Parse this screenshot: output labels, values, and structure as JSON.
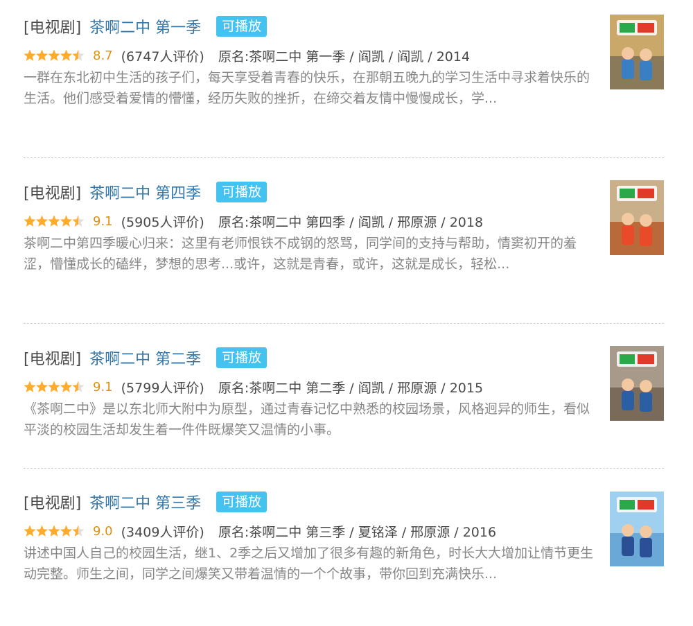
{
  "items": [
    {
      "category": "[电视剧]",
      "title": "茶啊二中 第一季",
      "badge": "可播放",
      "rating": 8.7,
      "rating_text": "8.7",
      "rating_count": "(6747人评价)",
      "meta": "原名:茶啊二中 第一季 / 阎凯 / 阎凯 / 2014",
      "abstract": "一群在东北初中生活的孩子们，每天享受着青春的快乐，在那朝五晚九的学习生活中寻求着快乐的生活。他们感受着爱情的懵懂，经历失败的挫折，在缔交着友情中慢慢成长，学...",
      "poster_colors": {
        "bg": "#8a7a5a",
        "accent": "#3a7fc4",
        "sky": "#c9a86a"
      }
    },
    {
      "category": "[电视剧]",
      "title": "茶啊二中 第四季",
      "badge": "可播放",
      "rating": 9.1,
      "rating_text": "9.1",
      "rating_count": "(5905人评价)",
      "meta": "原名:茶啊二中 第四季 / 阎凯 / 邢原源 / 2018",
      "abstract": "茶啊二中第四季暖心归来：这里有老师恨铁不成钢的怒骂，同学间的支持与帮助，情窦初开的羞涩，懵懂成长的磕绊，梦想的思考...或许，这就是青春，或许，这就是成长，轻松...",
      "poster_colors": {
        "bg": "#b86a3a",
        "accent": "#e94a2a",
        "sky": "#c9b08a"
      }
    },
    {
      "category": "[电视剧]",
      "title": "茶啊二中 第二季",
      "badge": "可播放",
      "rating": 9.1,
      "rating_text": "9.1",
      "rating_count": "(5799人评价)",
      "meta": "原名:茶啊二中 第二季 / 阎凯 / 邢原源 / 2015",
      "abstract": "《茶啊二中》是以东北师大附中为原型，通过青春记忆中熟悉的校园场景，风格迥异的师生，看似平淡的校园生活却发生着一件件既爆笑又温情的小事。",
      "poster_colors": {
        "bg": "#7a6a5a",
        "accent": "#2a5fa4",
        "sky": "#a89a8a"
      }
    },
    {
      "category": "[电视剧]",
      "title": "茶啊二中 第三季",
      "badge": "可播放",
      "rating": 9.0,
      "rating_text": "9.0",
      "rating_count": "(3409人评价)",
      "meta": "原名:茶啊二中 第三季 / 夏铭泽 / 邢原源 / 2016",
      "abstract": "讲述中国人自己的校园生活，继1、2季之后又增加了很多有趣的新角色，时长大大增加让情节更生动完整。师生之间，同学之间爆笑又带着温情的一个个故事，带你回到充满快乐...",
      "poster_colors": {
        "bg": "#6aa8d8",
        "accent": "#2a4f94",
        "sky": "#9fd0f0"
      }
    }
  ],
  "colors": {
    "title_link": "#3377aa",
    "badge_bg": "#44c2f0",
    "star_fill": "#ffac2d",
    "star_empty": "#e0e0e0",
    "rating_num": "#e09015",
    "abstract": "#878787"
  }
}
